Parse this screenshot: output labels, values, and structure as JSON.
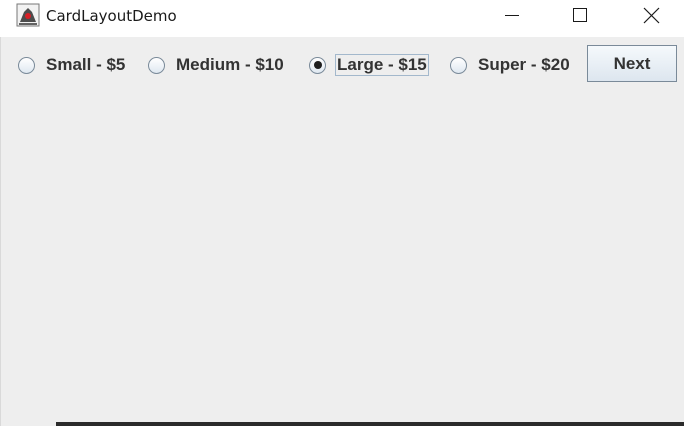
{
  "window": {
    "title": "CardLayoutDemo",
    "app_icon": "java-duke-icon",
    "controls": {
      "minimize_icon": "minimize-icon",
      "maximize_icon": "maximize-icon",
      "close_icon": "close-icon"
    }
  },
  "options": [
    {
      "label": "Small - $5",
      "checked": false
    },
    {
      "label": "Medium - $10",
      "checked": false
    },
    {
      "label": "Large - $15",
      "checked": true,
      "focused": true
    },
    {
      "label": "Super - $20",
      "checked": false
    }
  ],
  "next_button": {
    "label": "Next"
  },
  "colors": {
    "background": "#eeeeee",
    "titlebar": "#ffffff",
    "text": "#333333"
  }
}
